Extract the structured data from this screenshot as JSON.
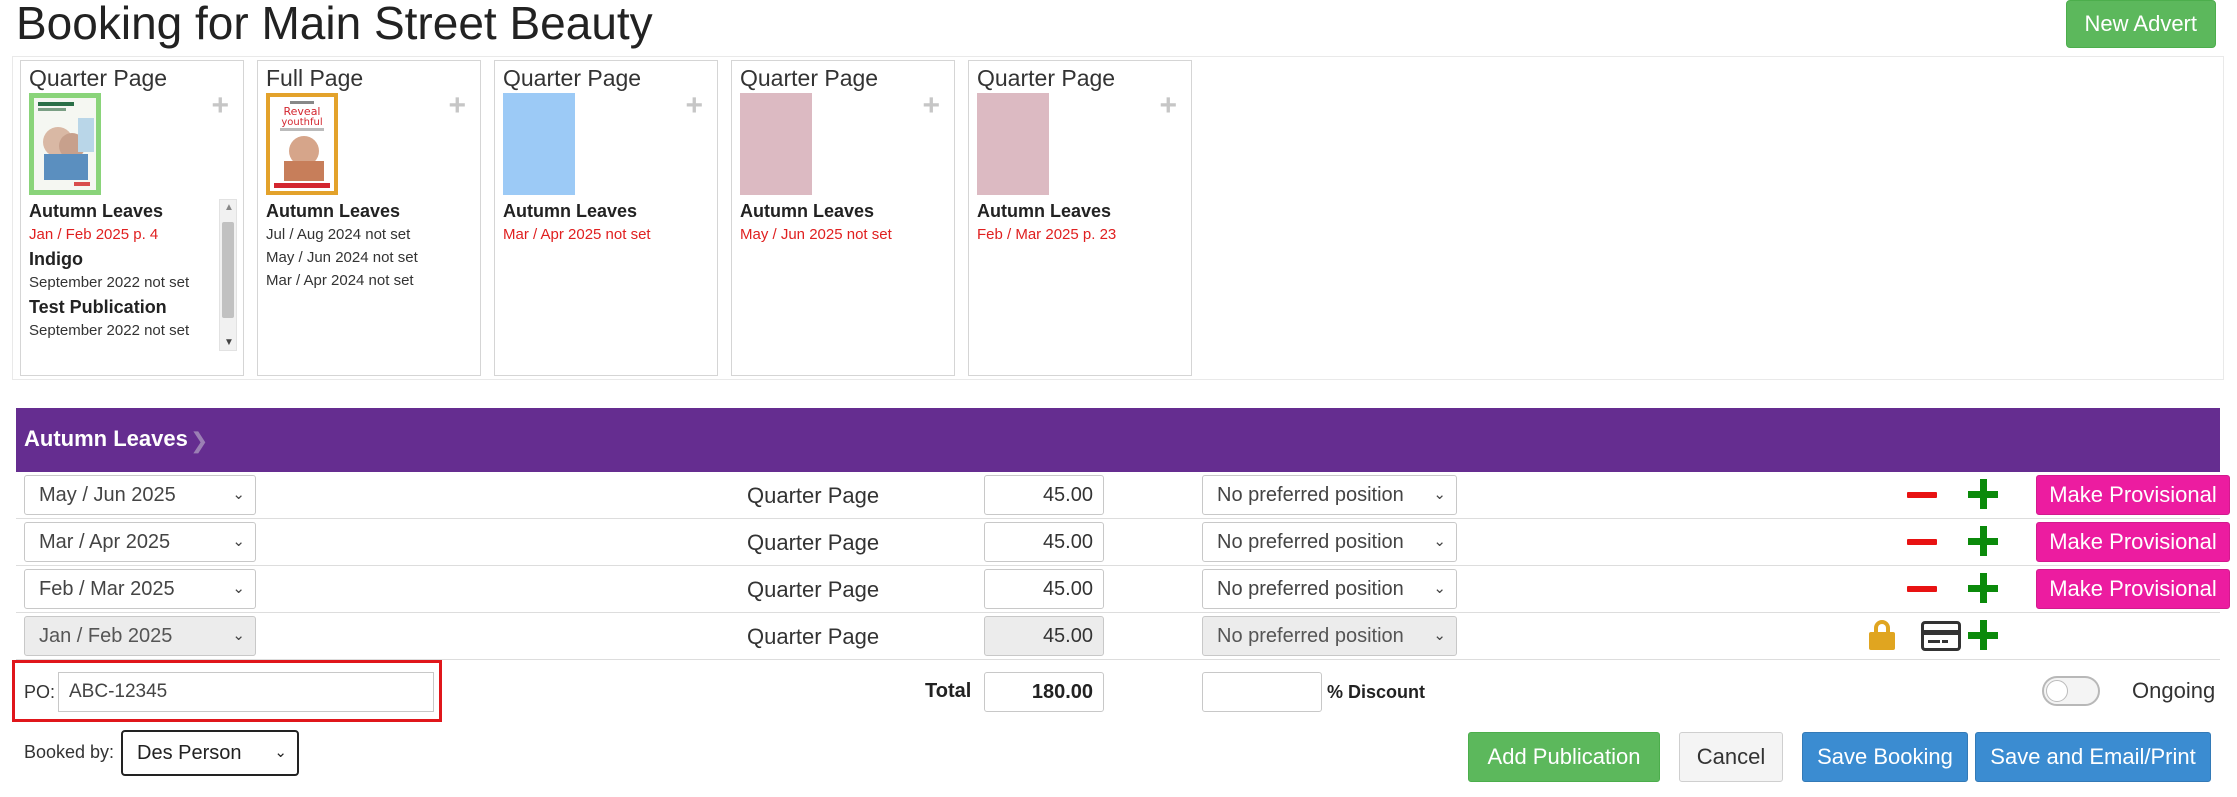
{
  "header": {
    "title": "Booking for Main Street Beauty",
    "new_advert_label": "New Advert"
  },
  "adverts": [
    {
      "size": "Quarter Page",
      "publications": [
        {
          "name": "Autumn Leaves",
          "issues": [
            {
              "text": "Jan / Feb 2025 p. 4",
              "red": true
            }
          ]
        },
        {
          "name": "Indigo",
          "issues": [
            {
              "text": "September 2022 not set",
              "red": false
            }
          ]
        },
        {
          "name": "Test Publication",
          "issues": [
            {
              "text": "September 2022 not set",
              "red": false
            }
          ]
        }
      ]
    },
    {
      "size": "Full Page",
      "publications": [
        {
          "name": "Autumn Leaves",
          "issues": [
            {
              "text": "Jul / Aug 2024 not set",
              "red": false
            },
            {
              "text": "May / Jun 2024 not set",
              "red": false
            },
            {
              "text": "Mar / Apr 2024 not set",
              "red": false
            }
          ]
        }
      ]
    },
    {
      "size": "Quarter Page",
      "publications": [
        {
          "name": "Autumn Leaves",
          "issues": [
            {
              "text": "Mar / Apr 2025 not set",
              "red": true
            }
          ]
        }
      ]
    },
    {
      "size": "Quarter Page",
      "publications": [
        {
          "name": "Autumn Leaves",
          "issues": [
            {
              "text": "May / Jun 2025 not set",
              "red": true
            }
          ]
        }
      ]
    },
    {
      "size": "Quarter Page",
      "publications": [
        {
          "name": "Autumn Leaves",
          "issues": [
            {
              "text": "Feb / Mar 2025 p. 23",
              "red": true
            }
          ]
        }
      ]
    }
  ],
  "section": {
    "publication": "Autumn Leaves"
  },
  "bookings": [
    {
      "issue": "May / Jun 2025",
      "size": "Quarter Page",
      "price": "45.00",
      "position": "No preferred position",
      "action": "Make Provisional",
      "locked": false
    },
    {
      "issue": "Mar / Apr 2025",
      "size": "Quarter Page",
      "price": "45.00",
      "position": "No preferred position",
      "action": "Make Provisional",
      "locked": false
    },
    {
      "issue": "Feb / Mar 2025",
      "size": "Quarter Page",
      "price": "45.00",
      "position": "No preferred position",
      "action": "Make Provisional",
      "locked": false
    },
    {
      "issue": "Jan / Feb 2025",
      "size": "Quarter Page",
      "price": "45.00",
      "position": "No preferred position",
      "action": "",
      "locked": true
    }
  ],
  "footer": {
    "po_label": "PO:",
    "po_value": "ABC-12345",
    "total_label": "Total",
    "total_value": "180.00",
    "discount_value": "",
    "discount_label": "% Discount",
    "ongoing_label": "Ongoing",
    "ongoing_on": false,
    "booked_by_label": "Booked by:",
    "booked_by_value": "Des Person",
    "add_publication_label": "Add Publication",
    "cancel_label": "Cancel",
    "save_label": "Save Booking",
    "save_email_label": "Save and Email/Print"
  },
  "colors": {
    "section_header": "#652d90",
    "make_provisional": "#ec1ca0",
    "primary": "#3b8cd1",
    "success": "#5cb85c",
    "highlight": "#e0161b"
  }
}
